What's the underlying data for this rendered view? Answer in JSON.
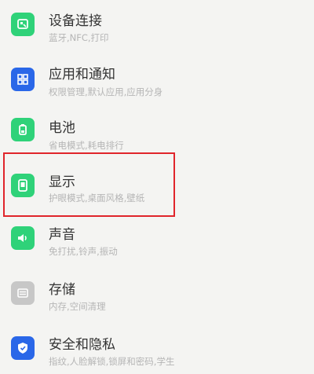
{
  "colors": {
    "green": "#2fd279",
    "blue": "#2a67e8",
    "gray": "#c7c7c7",
    "highlight": "#e0252b"
  },
  "items": [
    {
      "title": "设备连接",
      "subtitle": "蓝牙,NFC,打印",
      "icon": "device-connection-icon"
    },
    {
      "title": "应用和通知",
      "subtitle": "权限管理,默认应用,应用分身",
      "icon": "apps-grid-icon"
    },
    {
      "title": "电池",
      "subtitle": "省电模式,耗电排行",
      "icon": "battery-icon"
    },
    {
      "title": "显示",
      "subtitle": "护眼模式,桌面风格,壁纸",
      "icon": "display-icon"
    },
    {
      "title": "声音",
      "subtitle": "免打扰,铃声,振动",
      "icon": "sound-icon"
    },
    {
      "title": "存储",
      "subtitle": "内存,空间清理",
      "icon": "storage-icon"
    },
    {
      "title": "安全和隐私",
      "subtitle": "指纹,人脸解锁,锁屏和密码,学生",
      "icon": "security-shield-icon"
    }
  ]
}
